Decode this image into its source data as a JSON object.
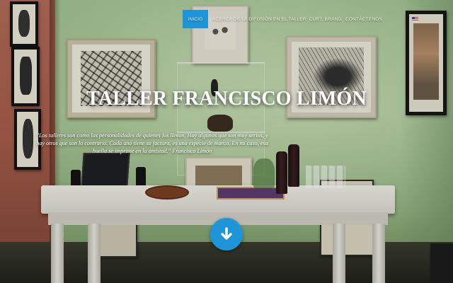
{
  "nav": {
    "items": [
      {
        "label": "INICIO",
        "active": true
      },
      {
        "label": "ACERCA DE LA DIFUSIÓN EN EL TALLER: CURT, BRANDEN & COMPAÑÍA",
        "active": false
      },
      {
        "label": "CONTÁCTENOS",
        "active": false
      }
    ],
    "language_flag": "us-flag-icon",
    "accent_color": "#1e95d8"
  },
  "hero": {
    "title": "TALLER FRANCISCO LIMÓN",
    "quote": "\"Los talleres son como las personalidades de quienes los llevan. Hay algunos que son muy serios, y hay otros que son lo contrario. Cada uno tiene su factura, es una especie de marco. En mi caso, esa huella se imprime en la amistad.\" Francisco Limón"
  },
  "scroll_button": {
    "icon": "arrow-down-icon",
    "color": "#1e95d8"
  }
}
